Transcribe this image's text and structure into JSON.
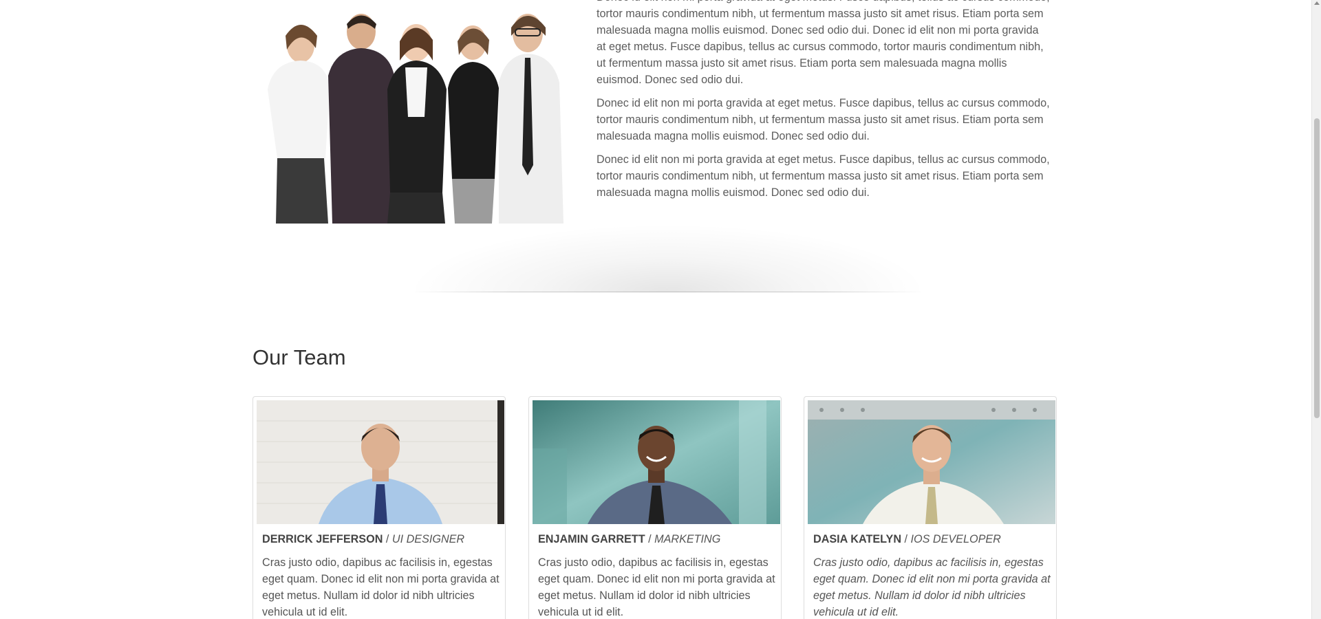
{
  "about": {
    "paragraphs": [
      "Donec id elit non mi porta gravida at eget metus. Fusce dapibus, tellus ac cursus commodo, tortor mauris condimentum nibh, ut fermentum massa justo sit amet risus. Etiam porta sem malesuada magna mollis euismod. Donec sed odio dui. Donec id elit non mi porta gravida at eget metus. Fusce dapibus, tellus ac cursus commodo, tortor mauris condimentum nibh, ut fermentum massa justo sit amet risus. Etiam porta sem malesuada magna mollis euismod. Donec sed odio dui.",
      "Donec id elit non mi porta gravida at eget metus. Fusce dapibus, tellus ac cursus commodo, tortor mauris condimentum nibh, ut fermentum massa justo sit amet risus. Etiam porta sem malesuada magna mollis euismod. Donec sed odio dui.",
      "Donec id elit non mi porta gravida at eget metus. Fusce dapibus, tellus ac cursus commodo, tortor mauris condimentum nibh, ut fermentum massa justo sit amet risus. Etiam porta sem malesuada magna mollis euismod. Donec sed odio dui."
    ]
  },
  "team": {
    "title": "Our Team",
    "separator": " / ",
    "members": [
      {
        "name": "DERRICK JEFFERSON",
        "role": "UI DESIGNER",
        "description": "Cras justo odio, dapibus ac facilisis in, egestas eget quam. Donec id elit non mi porta gravida at eget metus. Nullam id dolor id nibh ultricies vehicula ut id elit."
      },
      {
        "name": "ENJAMIN GARRETT",
        "role": "MARKETING",
        "description": "Cras justo odio, dapibus ac facilisis in, egestas eget quam. Donec id elit non mi porta gravida at eget metus. Nullam id dolor id nibh ultricies vehicula ut id elit."
      },
      {
        "name": "DASIA KATELYN",
        "role": "IOS DEVELOPER",
        "description": "Cras justo odio, dapibus ac facilisis in, egestas eget quam. Donec id elit non mi porta gravida at eget metus. Nullam id dolor id nibh ultricies vehicula ut id elit."
      }
    ]
  },
  "colors": {
    "body_text": "#555555",
    "heading": "#333333",
    "card_border": "#dddddd"
  }
}
